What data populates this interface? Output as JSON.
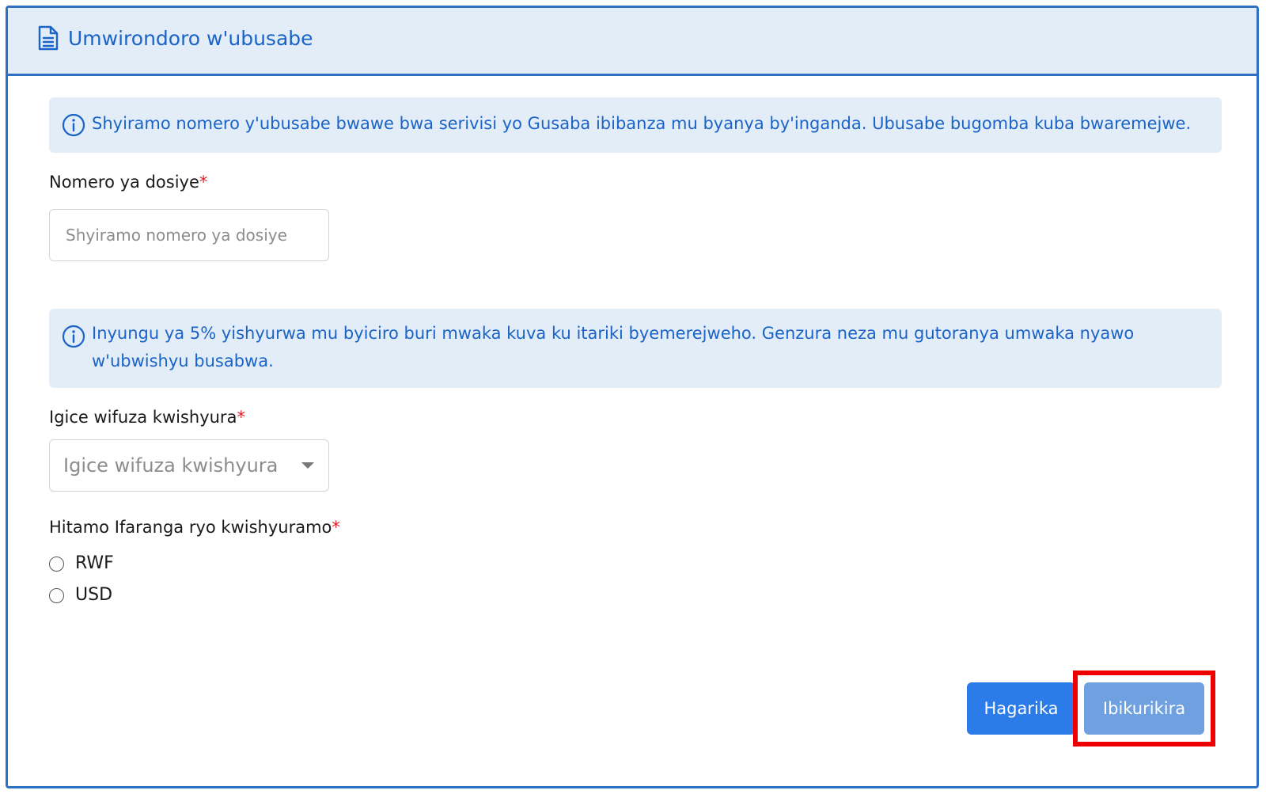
{
  "header": {
    "title": "Umwirondoro w'ubusabe"
  },
  "notices": {
    "file_info": "Shyiramo nomero y'ubusabe bwawe bwa serivisi yo Gusaba ibibanza mu byanya by'inganda. Ubusabe bugomba kuba bwaremejwe.",
    "interest_info": "Inyungu ya 5% yishyurwa mu byiciro buri mwaka kuva ku itariki byemerejweho. Genzura neza mu gutoranya umwaka nyawo w'ubwishyu busabwa."
  },
  "form": {
    "file_number": {
      "label": "Nomero ya dosiye",
      "required_mark": "*",
      "value": "",
      "placeholder": "Shyiramo nomero ya dosiye"
    },
    "part_to_pay": {
      "label": "Igice wifuza kwishyura",
      "required_mark": "*",
      "selected": "Igice wifuza kwishyura"
    },
    "currency": {
      "label": "Hitamo Ifaranga ryo kwishyuramo",
      "required_mark": "*",
      "options": [
        "RWF",
        "USD"
      ]
    }
  },
  "actions": {
    "cancel_label": "Hagarika",
    "submit_label": "Ibikurikira"
  },
  "colors": {
    "primary": "#2b7be8",
    "primary_disabled": "#6fa0e0",
    "header_bg": "#e3edf8",
    "border": "#2f6fc4",
    "info_text": "#1a63c8",
    "required": "#e0202a",
    "highlight": "#ee0000"
  }
}
